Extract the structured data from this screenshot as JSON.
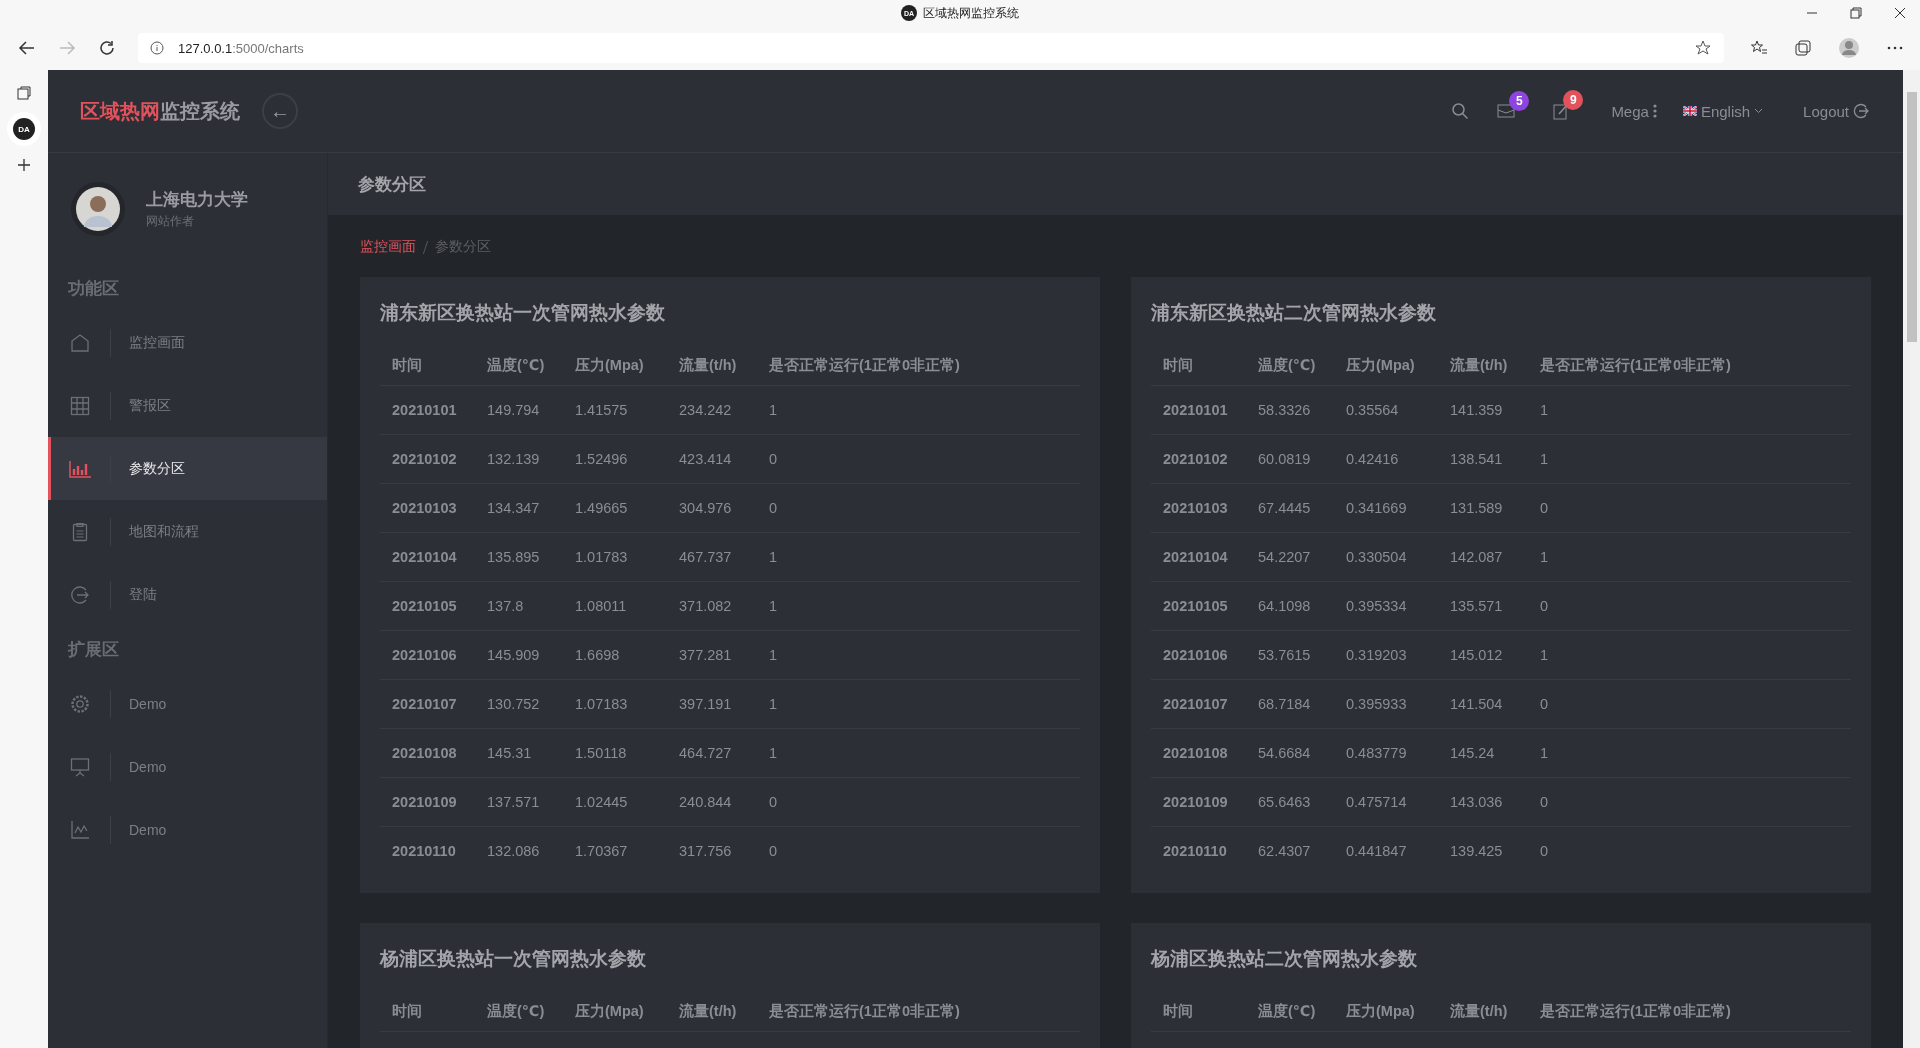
{
  "browser": {
    "tab_favicon": "DA",
    "title": "区域热网监控系统",
    "strip_favicon": "DA",
    "url_host": "127.0.0.1",
    "url_path": ":5000/charts"
  },
  "header": {
    "logo_highlight": "区域热网",
    "logo_rest": "监控系统",
    "back_icon": "←",
    "badges": [
      {
        "kind": "mail",
        "count": "5",
        "color": "#8e44e0"
      },
      {
        "kind": "edit",
        "count": "9",
        "color": "#e2525c"
      }
    ],
    "user": "Mega",
    "language": "English",
    "logout": "Logout"
  },
  "profile": {
    "name": "上海电力大学",
    "role": "网站作者"
  },
  "sidebar": [
    {
      "title": "功能区",
      "items": [
        {
          "label": "监控画面",
          "kind": "home",
          "selected": false
        },
        {
          "label": "警报区",
          "kind": "grid",
          "selected": false
        },
        {
          "label": "参数分区",
          "kind": "chart",
          "selected": true
        },
        {
          "label": "地图和流程",
          "kind": "clipboard",
          "selected": false
        },
        {
          "label": "登陆",
          "kind": "login",
          "selected": false
        }
      ]
    },
    {
      "title": "扩展区",
      "items": [
        {
          "label": "Demo",
          "kind": "gear",
          "selected": false
        },
        {
          "label": "Demo",
          "kind": "presentation",
          "selected": false
        },
        {
          "label": "Demo",
          "kind": "linechart",
          "selected": false
        }
      ]
    }
  ],
  "page_title": "参数分区",
  "breadcrumb": [
    {
      "label": "监控画面",
      "selected": false
    },
    {
      "label": "参数分区",
      "selected": true
    }
  ],
  "tables": [
    {
      "title": "浦东新区换热站一次管网热水参数",
      "columns": [
        "时间",
        "温度(℃)",
        "压力(Mpa)",
        "流量(t/h)",
        "是否正常运行(1正常0非正常)"
      ],
      "rows": [
        [
          "20210101",
          "149.794",
          "1.41575",
          "234.242",
          "1"
        ],
        [
          "20210102",
          "132.139",
          "1.52496",
          "423.414",
          "0"
        ],
        [
          "20210103",
          "134.347",
          "1.49665",
          "304.976",
          "0"
        ],
        [
          "20210104",
          "135.895",
          "1.01783",
          "467.737",
          "1"
        ],
        [
          "20210105",
          "137.8",
          "1.08011",
          "371.082",
          "1"
        ],
        [
          "20210106",
          "145.909",
          "1.6698",
          "377.281",
          "1"
        ],
        [
          "20210107",
          "130.752",
          "1.07183",
          "397.191",
          "1"
        ],
        [
          "20210108",
          "145.31",
          "1.50118",
          "464.727",
          "1"
        ],
        [
          "20210109",
          "137.571",
          "1.02445",
          "240.844",
          "0"
        ],
        [
          "20210110",
          "132.086",
          "1.70367",
          "317.756",
          "0"
        ]
      ]
    },
    {
      "title": "浦东新区换热站二次管网热水参数",
      "columns": [
        "时间",
        "温度(℃)",
        "压力(Mpa)",
        "流量(t/h)",
        "是否正常运行(1正常0非正常)"
      ],
      "rows": [
        [
          "20210101",
          "58.3326",
          "0.35564",
          "141.359",
          "1"
        ],
        [
          "20210102",
          "60.0819",
          "0.42416",
          "138.541",
          "1"
        ],
        [
          "20210103",
          "67.4445",
          "0.341669",
          "131.589",
          "0"
        ],
        [
          "20210104",
          "54.2207",
          "0.330504",
          "142.087",
          "1"
        ],
        [
          "20210105",
          "64.1098",
          "0.395334",
          "135.571",
          "0"
        ],
        [
          "20210106",
          "53.7615",
          "0.319203",
          "145.012",
          "1"
        ],
        [
          "20210107",
          "68.7184",
          "0.395933",
          "141.504",
          "0"
        ],
        [
          "20210108",
          "54.6684",
          "0.483779",
          "145.24",
          "1"
        ],
        [
          "20210109",
          "65.6463",
          "0.475714",
          "143.036",
          "0"
        ],
        [
          "20210110",
          "62.4307",
          "0.441847",
          "139.425",
          "0"
        ]
      ]
    },
    {
      "title": "杨浦区换热站一次管网热水参数",
      "columns": [
        "时间",
        "温度(℃)",
        "压力(Mpa)",
        "流量(t/h)",
        "是否正常运行(1正常0非正常)"
      ]
    },
    {
      "title": "杨浦区换热站二次管网热水参数",
      "columns": [
        "时间",
        "温度(℃)",
        "压力(Mpa)",
        "流量(t/h)",
        "是否正常运行(1正常0非正常)"
      ]
    }
  ]
}
